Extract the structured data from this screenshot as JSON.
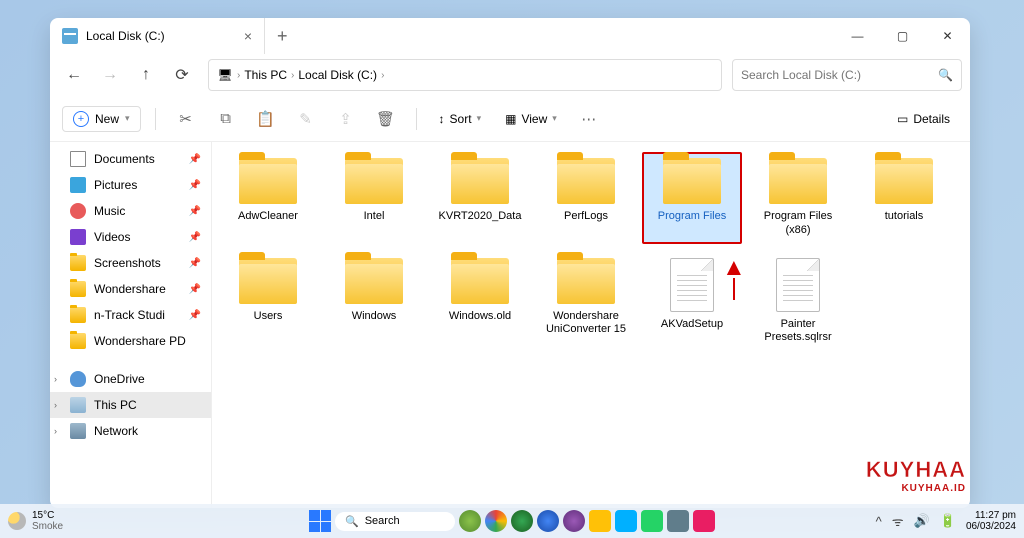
{
  "window": {
    "tab_title": "Local Disk (C:)",
    "breadcrumb": [
      "This PC",
      "Local Disk (C:)"
    ],
    "search_placeholder": "Search Local Disk (C:)"
  },
  "toolbar": {
    "new_label": "New",
    "sort_label": "Sort",
    "view_label": "View",
    "details_label": "Details"
  },
  "sidebar": {
    "quick": [
      {
        "label": "Documents",
        "icon": "doc",
        "pinned": true
      },
      {
        "label": "Pictures",
        "icon": "pic",
        "pinned": true
      },
      {
        "label": "Music",
        "icon": "music",
        "pinned": true
      },
      {
        "label": "Videos",
        "icon": "video",
        "pinned": true
      },
      {
        "label": "Screenshots",
        "icon": "folder",
        "pinned": true
      },
      {
        "label": "Wondershare",
        "icon": "folder",
        "pinned": true
      },
      {
        "label": "n-Track Studi",
        "icon": "folder",
        "pinned": true
      },
      {
        "label": "Wondershare PD",
        "icon": "folder",
        "pinned": false
      }
    ],
    "tree": [
      {
        "label": "OneDrive",
        "icon": "cloud",
        "selected": false
      },
      {
        "label": "This PC",
        "icon": "drive",
        "selected": true
      },
      {
        "label": "Network",
        "icon": "net",
        "selected": false
      }
    ]
  },
  "items": [
    {
      "label": "AdwCleaner",
      "type": "folder",
      "selected": false
    },
    {
      "label": "Intel",
      "type": "folder",
      "selected": false
    },
    {
      "label": "KVRT2020_Data",
      "type": "folder",
      "selected": false
    },
    {
      "label": "PerfLogs",
      "type": "folder",
      "selected": false
    },
    {
      "label": "Program Files",
      "type": "folder",
      "selected": true
    },
    {
      "label": "Program Files (x86)",
      "type": "folder",
      "selected": false
    },
    {
      "label": "tutorials",
      "type": "folder",
      "selected": false
    },
    {
      "label": "Users",
      "type": "folder",
      "selected": false
    },
    {
      "label": "Windows",
      "type": "folder",
      "selected": false
    },
    {
      "label": "Windows.old",
      "type": "folder",
      "selected": false
    },
    {
      "label": "Wondershare UniConverter 15",
      "type": "folder",
      "selected": false
    },
    {
      "label": "AKVadSetup",
      "type": "file",
      "selected": false
    },
    {
      "label": "Painter Presets.sqlrsr",
      "type": "file",
      "selected": false
    }
  ],
  "taskbar": {
    "weather_temp": "15°C",
    "weather_cond": "Smoke",
    "search_label": "Search",
    "time": "11:27 pm",
    "date": "06/03/2024"
  },
  "watermark": {
    "line1": "KUYHAA",
    "line2": "KUYHAA.ID"
  }
}
